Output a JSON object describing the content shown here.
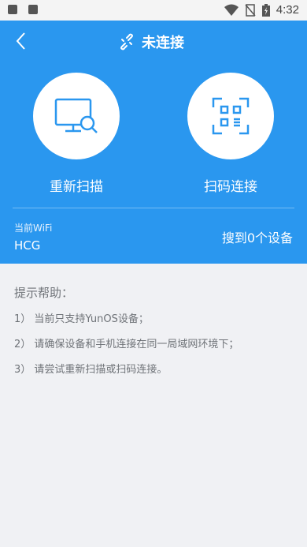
{
  "status_bar": {
    "time": "4:32",
    "icons": [
      "image-notification-icon",
      "text-notification-icon",
      "wifi-icon",
      "no-sim-icon",
      "battery-charging-icon"
    ]
  },
  "header": {
    "title": "未连接",
    "title_icon": "broken-link-icon",
    "back_icon": "chevron-left-icon"
  },
  "actions": [
    {
      "label": "重新扫描",
      "icon": "monitor-search-icon"
    },
    {
      "label": "扫码连接",
      "icon": "qr-scan-icon"
    }
  ],
  "wifi": {
    "caption": "当前WiFi",
    "name": "HCG",
    "found": "搜到0个设备"
  },
  "help": {
    "title": "提示帮助：",
    "items": [
      "1） 当前只支持YunOS设备；",
      "2） 请确保设备和手机连接在同一局域网环境下；",
      "3） 请尝试重新扫描或扫码连接。"
    ]
  },
  "colors": {
    "primary": "#2a97ef",
    "background": "#f0f1f4",
    "help_text": "#6f7378"
  }
}
